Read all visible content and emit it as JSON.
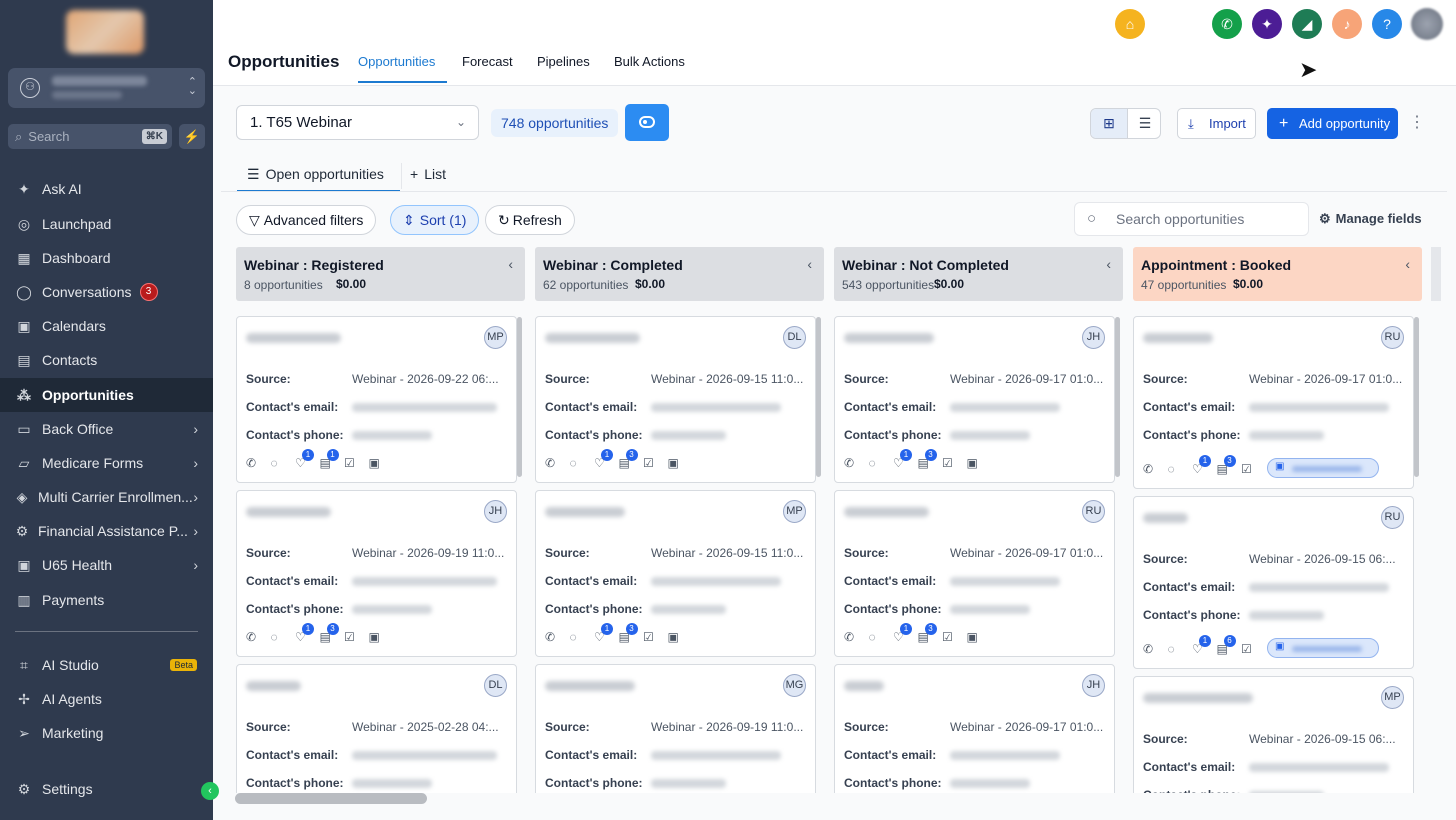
{
  "sidebar": {
    "search_placeholder": "Search",
    "search_shortcut": "⌘K",
    "items": [
      {
        "label": "Ask AI",
        "icon": "sparkle-icon"
      },
      {
        "label": "Launchpad",
        "icon": "rocket-icon"
      },
      {
        "label": "Dashboard",
        "icon": "dashboard-icon"
      },
      {
        "label": "Conversations",
        "icon": "chat-icon",
        "count": "3"
      },
      {
        "label": "Calendars",
        "icon": "calendar-icon"
      },
      {
        "label": "Contacts",
        "icon": "contacts-icon"
      },
      {
        "label": "Opportunities",
        "icon": "opportunities-icon",
        "active": true
      },
      {
        "label": "Back Office",
        "icon": "back-office-icon"
      },
      {
        "label": "Medicare Forms",
        "icon": "folder-icon"
      },
      {
        "label": "Multi Carrier Enrollmen...",
        "icon": "layers-icon"
      },
      {
        "label": "Financial Assistance P...",
        "icon": "gear-icon"
      },
      {
        "label": "U65 Health",
        "icon": "briefcase-icon"
      },
      {
        "label": "Payments",
        "icon": "receipt-icon"
      },
      {
        "label": "AI Studio",
        "icon": "ai-studio-icon",
        "badge": "Beta"
      },
      {
        "label": "AI Agents",
        "icon": "ai-agents-icon"
      },
      {
        "label": "Marketing",
        "icon": "send-icon"
      },
      {
        "label": "Settings",
        "icon": "gear-icon"
      }
    ]
  },
  "header": {
    "title": "Opportunities",
    "tabs": [
      "Opportunities",
      "Forecast",
      "Pipelines",
      "Bulk Actions"
    ]
  },
  "toolbar": {
    "pipeline": "1. T65 Webinar",
    "opportunity_count": "748 opportunities",
    "import_label": "Import",
    "add_label": "Add opportunity"
  },
  "subtabs": {
    "open": "Open opportunities",
    "list": "List"
  },
  "filters": {
    "advanced": "Advanced filters",
    "sort": "Sort (1)",
    "refresh": "Refresh",
    "search_placeholder": "Search opportunities",
    "manage_fields": "Manage fields"
  },
  "card_labels": {
    "source": "Source:",
    "email": "Contact's email:",
    "phone": "Contact's phone:"
  },
  "columns": [
    {
      "title": "Webinar : Registered",
      "count": "8 opportunities",
      "value": "$0.00",
      "cards": [
        {
          "initials": "MP",
          "source": "Webinar - 2026-09-22 06:...",
          "badges": [
            "1",
            "1"
          ]
        },
        {
          "initials": "JH",
          "source": "Webinar - 2026-09-19 11:0...",
          "badges": [
            "1",
            "3"
          ]
        },
        {
          "initials": "DL",
          "source": "Webinar - 2025-02-28 04:..."
        }
      ]
    },
    {
      "title": "Webinar : Completed",
      "count": "62 opportunities",
      "value": "$0.00",
      "cards": [
        {
          "initials": "DL",
          "source": "Webinar - 2026-09-15 11:0...",
          "badges": [
            "1",
            "3"
          ]
        },
        {
          "initials": "MP",
          "source": "Webinar - 2026-09-15 11:0...",
          "badges": [
            "1",
            "3"
          ]
        },
        {
          "initials": "MG",
          "source": "Webinar - 2026-09-19 11:0..."
        }
      ]
    },
    {
      "title": "Webinar : Not Completed",
      "count": "543 opportunities",
      "value": "$0.00",
      "cards": [
        {
          "initials": "JH",
          "source": "Webinar - 2026-09-17 01:0...",
          "badges": [
            "1",
            "3"
          ]
        },
        {
          "initials": "RU",
          "source": "Webinar - 2026-09-17 01:0...",
          "badges": [
            "1",
            "3"
          ]
        },
        {
          "initials": "JH",
          "source": "Webinar - 2026-09-17 01:0..."
        }
      ]
    },
    {
      "title": "Appointment : Booked",
      "count": "47 opportunities",
      "value": "$0.00",
      "cards": [
        {
          "initials": "RU",
          "source": "Webinar - 2026-09-17 01:0...",
          "badges": [
            "1",
            "3"
          ]
        },
        {
          "initials": "RU",
          "source": "Webinar - 2026-09-15 06:...",
          "badges": [
            "1",
            "6"
          ]
        },
        {
          "initials": "MP",
          "source": "Webinar - 2026-09-15 06:..."
        }
      ]
    }
  ]
}
